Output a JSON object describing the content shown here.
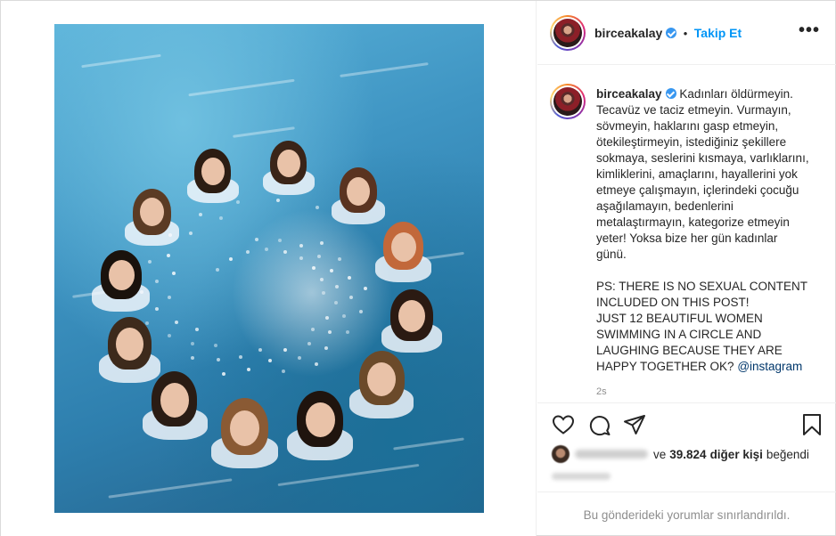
{
  "post": {
    "username": "birceakalay",
    "follow_label": "Takip Et",
    "separator": "•",
    "more_icon": "more-horizontal-icon",
    "caption_lines": [
      "Kadınları öldürmeyin.",
      "Tecavüz ve taciz etmeyin. Vurmayın,",
      "sövmeyin, haklarını gasp etmeyin,",
      "ötekileştirmeyin, istediğiniz şekillere",
      "sokmaya, seslerini kısmaya, varlıklarını,",
      "kimliklerini, amaçlarını, hayallerini yok",
      "etmeye çalışmayın, içlerindeki çocuğu",
      "aşağılamayın, bedenlerini",
      "metalaştırmayın, kategorize etmeyin",
      "yeter! Yoksa bize her gün kadınlar",
      "günü."
    ],
    "caption_ps_lines": [
      "PS: THERE IS NO SEXUAL CONTENT",
      "INCLUDED ON THIS POST!",
      "JUST 12 BEAUTIFUL WOMEN",
      "SWIMMING IN A CIRCLE AND",
      "LAUGHING BECAUSE THEY ARE",
      "HAPPY TOGETHER OK?"
    ],
    "mention": "@instagram",
    "time_ago": "2s",
    "likes": {
      "connector": "ve",
      "count": "39.824",
      "others_label": "diğer kişi",
      "suffix": "beğendi"
    },
    "comments_disabled_text": "Bu gönderideki yorumlar sınırlandırıldı.",
    "image_alt": "Twelve women in white shirts swimming in a circle in blue water"
  },
  "icons": {
    "like": "heart-icon",
    "comment": "comment-icon",
    "share": "send-icon",
    "save": "bookmark-icon"
  },
  "colors": {
    "link_blue": "#0095f6",
    "verified_blue": "#3897f0",
    "text": "#262626",
    "muted": "#8e8e8e",
    "border": "#efefef"
  }
}
